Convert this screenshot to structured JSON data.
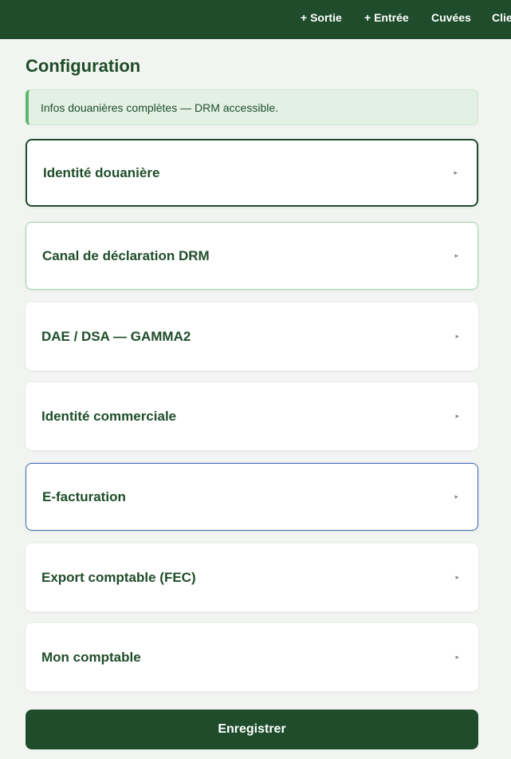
{
  "topbar": {
    "items": [
      {
        "label": "+ Sortie"
      },
      {
        "label": "+ Entrée"
      },
      {
        "label": "Cuvées"
      },
      {
        "label": "Clie"
      }
    ]
  },
  "page": {
    "title": "Configuration"
  },
  "banner": {
    "text": "Infos douanières complètes — DRM accessible."
  },
  "sections": [
    {
      "label": "Identité douanière",
      "chevron": "▸"
    },
    {
      "label": "Canal de déclaration DRM",
      "chevron": "▸"
    },
    {
      "label": "DAE / DSA — GAMMA2",
      "chevron": "▸"
    },
    {
      "label": "Identité commerciale",
      "chevron": "▸"
    },
    {
      "label": "E-facturation",
      "chevron": "▸"
    },
    {
      "label": "Export comptable (FEC)",
      "chevron": "▸"
    },
    {
      "label": "Mon comptable",
      "chevron": "▸"
    }
  ],
  "actions": {
    "save_label": "Enregistrer"
  },
  "colors": {
    "brand": "#1f4d2b",
    "banner_bg": "#e3f1e5",
    "banner_accent": "#5cb86e",
    "focus_blue": "#3a63b8"
  }
}
